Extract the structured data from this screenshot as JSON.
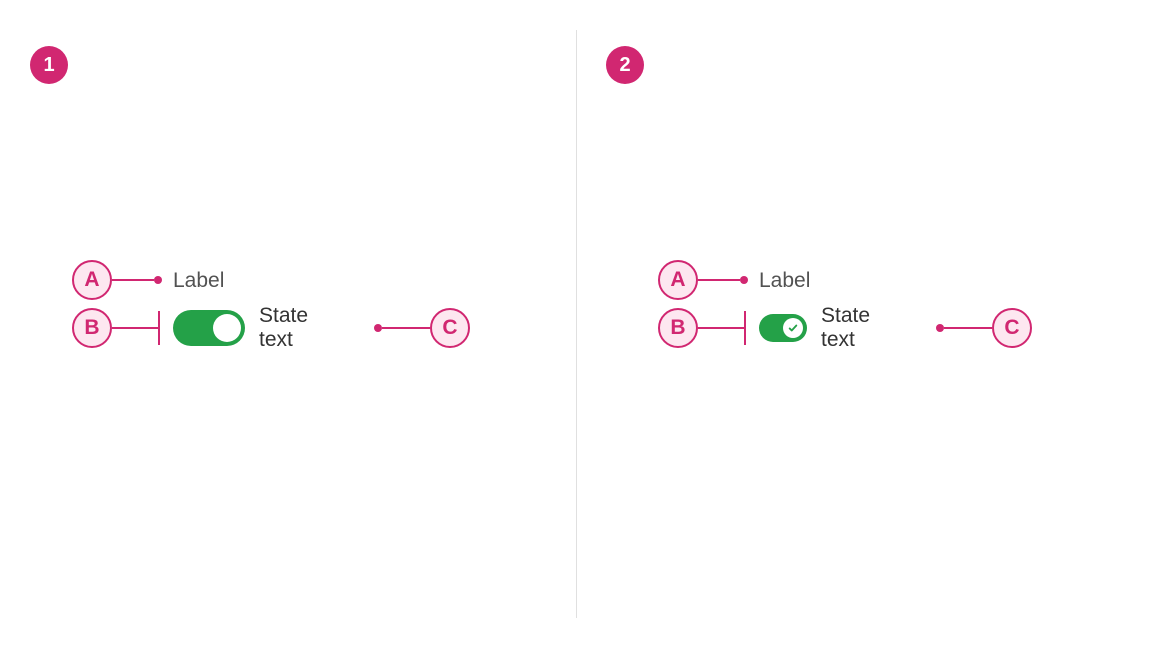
{
  "badges": {
    "panel1": "1",
    "panel2": "2"
  },
  "annotations": {
    "a": "A",
    "b": "B",
    "c": "C"
  },
  "panel1": {
    "label": "Label",
    "stateText": "State text"
  },
  "panel2": {
    "label": "Label",
    "stateText": "State text"
  },
  "colors": {
    "accent": "#d12771",
    "toggleOn": "#24a148",
    "text": "#525252"
  }
}
